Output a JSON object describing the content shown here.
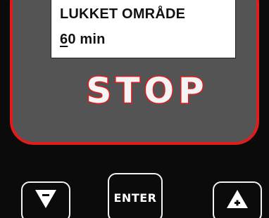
{
  "display": {
    "line1": "LUKKET OMRÅDE",
    "line2_cursor": "6",
    "line2_rest": "0 min"
  },
  "status": {
    "label": "STOP"
  },
  "keys": {
    "down_icon": "triangle-down-minus-icon",
    "enter_label": "ENTER",
    "up_icon": "triangle-up-plus-icon"
  },
  "colors": {
    "accent_red": "#e21b1b",
    "panel_gray": "#545454",
    "housing_black": "#0b0b0b",
    "lcd_background": "#ffffff"
  }
}
